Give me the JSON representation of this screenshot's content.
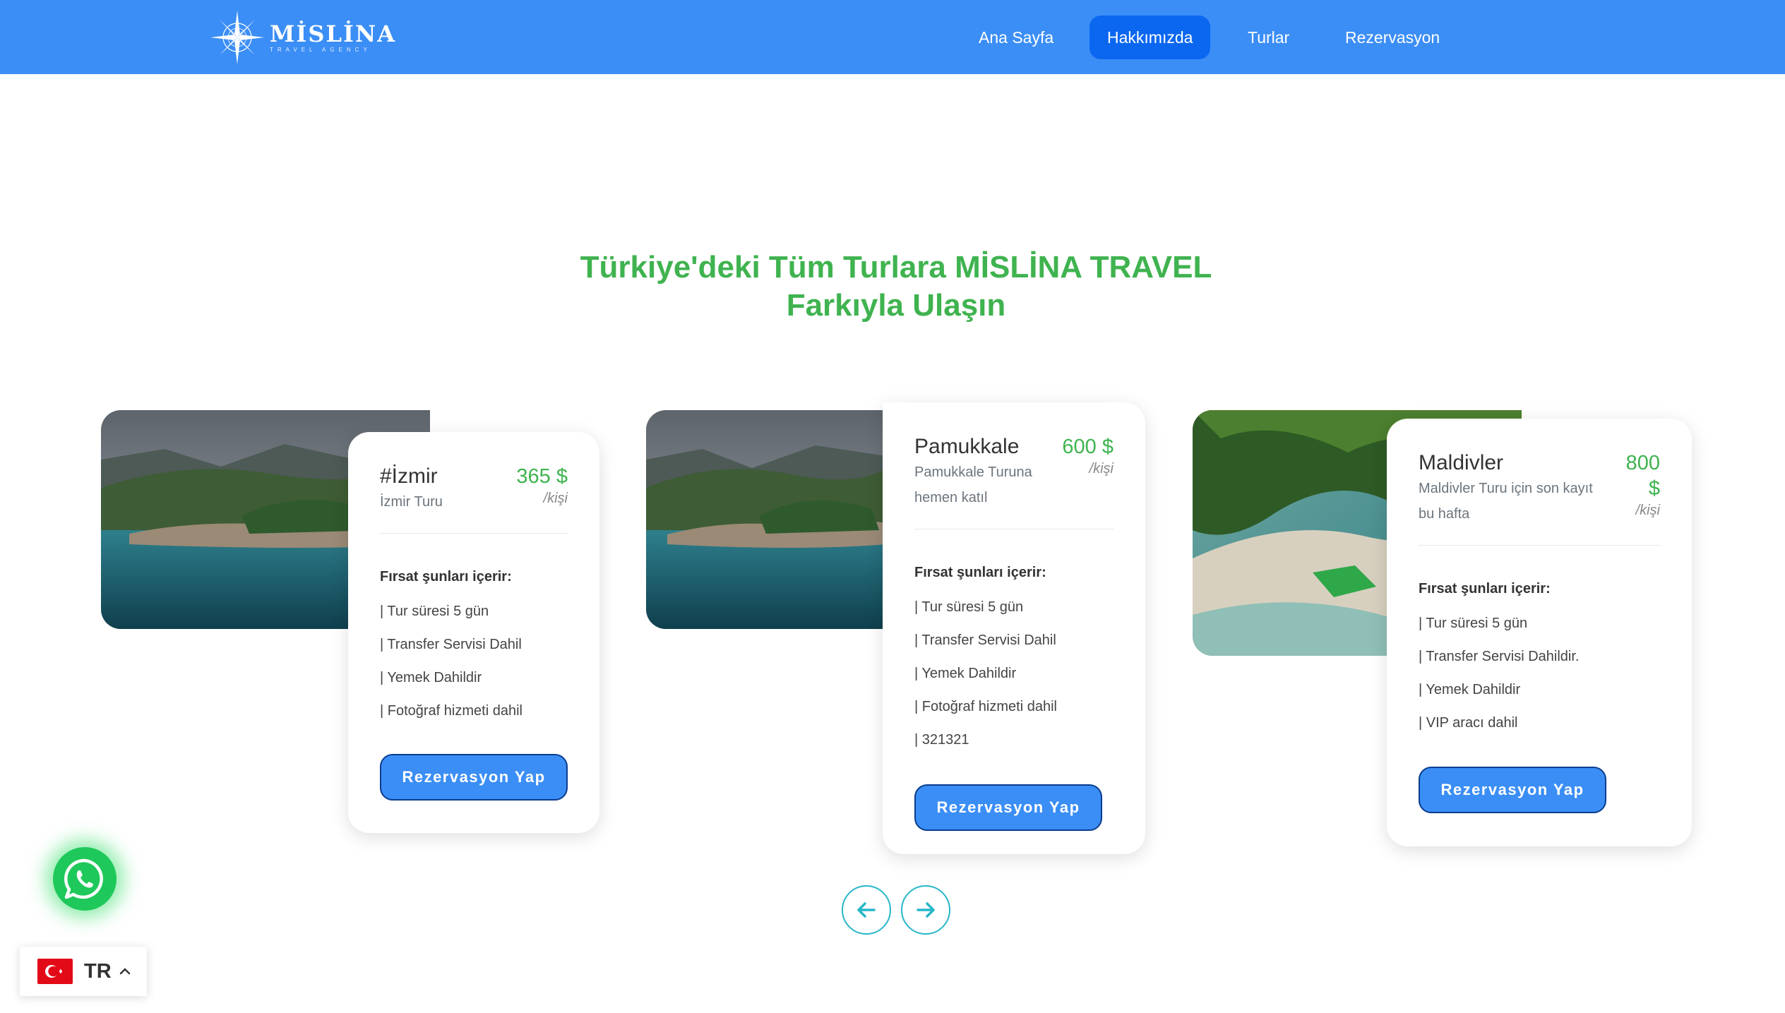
{
  "brand": {
    "name": "MİSLİNA",
    "tagline": "TRAVEL AGENCY"
  },
  "nav": [
    {
      "label": "Ana Sayfa",
      "active": false
    },
    {
      "label": "Hakkımızda",
      "active": true
    },
    {
      "label": "Turlar",
      "active": false
    },
    {
      "label": "Rezervasyon",
      "active": false
    }
  ],
  "headline": {
    "line1": "Türkiye'deki Tüm Turlara MİSLİNA TRAVEL",
    "line2": "Farkıyla Ulaşın"
  },
  "tours": [
    {
      "title": "#İzmir",
      "subtitle": "İzmir Turu",
      "price": "365 $",
      "per": "/kişi",
      "features_title": "Fırsat şunları içerir:",
      "features": [
        "| Tur süresi 5 gün",
        "| Transfer Servisi Dahil",
        "| Yemek Dahildir",
        "| Fotoğraf hizmeti dahil"
      ],
      "button": "Rezervasyon Yap",
      "image": "coastal-bay-photo"
    },
    {
      "title": "Pamukkale",
      "subtitle": "Pamukkale Turuna hemen katıl",
      "price": "600 $",
      "per": "/kişi",
      "features_title": "Fırsat şunları içerir:",
      "features": [
        "| Tur süresi 5 gün",
        "| Transfer Servisi Dahil",
        "| Yemek Dahildir",
        "| Fotoğraf hizmeti dahil",
        "| 321321"
      ],
      "button": "Rezervasyon Yap",
      "image": "coastal-bay-photo"
    },
    {
      "title": "Maldivler",
      "subtitle": "Maldivler Turu için son kayıt bu hafta",
      "price": "800 $",
      "per": "/kişi",
      "features_title": "Fırsat şunları içerir:",
      "features": [
        "| Tur süresi 5 gün",
        "| Transfer Servisi Dahildir.",
        "| Yemek Dahildir",
        "| VIP aracı dahil"
      ],
      "button": "Rezervasyon Yap",
      "image": "tropical-beach-photo"
    }
  ],
  "slider": {
    "prev_icon": "arrow-left-icon",
    "next_icon": "arrow-right-icon"
  },
  "whatsapp": {
    "icon": "whatsapp-icon"
  },
  "language": {
    "code": "TR",
    "flag": "turkey-flag-icon",
    "caret": "chevron-up-icon"
  },
  "colors": {
    "nav_bg": "#3b8ef5",
    "nav_active": "#0b67f0",
    "accent_green": "#3fb34f",
    "button": "#3b8ef5",
    "arrow": "#27b7c8"
  }
}
